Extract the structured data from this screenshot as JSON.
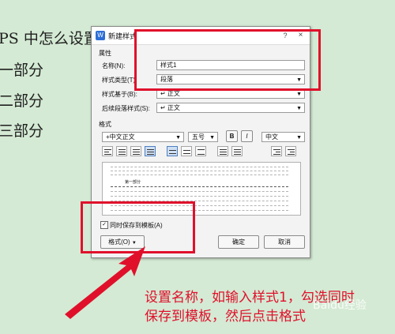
{
  "document": {
    "title": "PS 中怎么设置",
    "parts": [
      "一部分",
      "二部分",
      "三部分"
    ]
  },
  "dialog": {
    "title": "新建样式",
    "help": "?",
    "close": "×",
    "properties_group": "属性",
    "name_label": "名称(N):",
    "name_value": "样式1",
    "type_label": "样式类型(T):",
    "type_value": "段落",
    "based_on_label": "样式基于(B):",
    "based_on_value": "↵ 正文",
    "next_label": "后续段落样式(S):",
    "next_value": "↵ 正文",
    "format_group": "格式",
    "font_value": "+中文正文",
    "size_value": "五号",
    "bold": "B",
    "italic": "I",
    "lang_value": "中文",
    "preview_sample": "第一部分",
    "save_template_label": "同时保存到模板(A)",
    "save_template_checked": true,
    "format_button": "格式(O)",
    "ok_button": "确定",
    "cancel_button": "取消"
  },
  "annotation": {
    "line1": "设置名称，如输入样式1，勾选同时",
    "line2": "保存到模板，然后点击格式",
    "color": "#e0102b"
  },
  "watermark": "Baidu经验"
}
